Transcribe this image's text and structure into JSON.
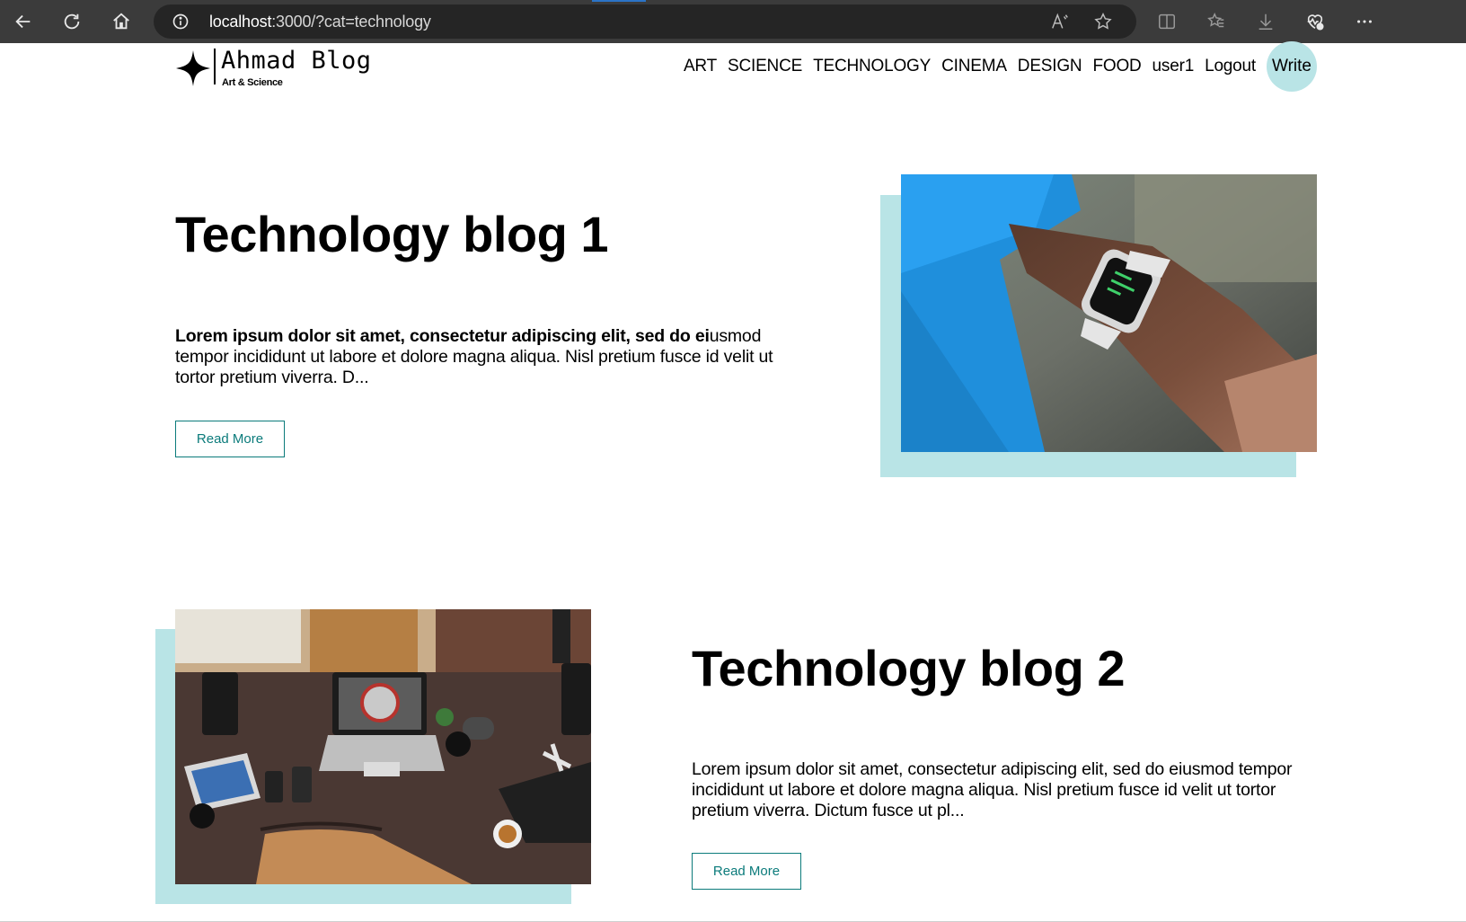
{
  "browser": {
    "url_host": "localhost",
    "url_rest": ":3000/?cat=technology",
    "icons": [
      "back-icon",
      "refresh-icon",
      "home-icon",
      "info-icon",
      "read-aloud-icon",
      "favorite-star-icon",
      "split-screen-icon",
      "favorites-list-icon",
      "downloads-icon",
      "browser-essentials-icon",
      "more-icon"
    ]
  },
  "header": {
    "logo_name": "Ahmad Blog",
    "logo_tagline": "Art & Science",
    "nav": [
      "ART",
      "SCIENCE",
      "TECHNOLOGY",
      "CINEMA",
      "DESIGN",
      "FOOD",
      "user1",
      "Logout"
    ],
    "write_label": "Write"
  },
  "posts": [
    {
      "title": "Technology blog 1",
      "desc_bold": "Lorem ipsum dolor sit amet, consectetur adipiscing elit, sed do ei",
      "desc_rest": "usmod tempor incididunt ut labore et dolore magna aliqua. Nisl pretium fusce id velit ut tortor pretium viverra. D...",
      "read_more": "Read More",
      "image": "smartwatch-on-wrist"
    },
    {
      "title": "Technology blog 2",
      "desc_bold": "",
      "desc_rest": "Lorem ipsum dolor sit amet, consectetur adipiscing elit, sed do eiusmod tempor incididunt ut labore et dolore magna aliqua. Nisl pretium fusce id velit ut tortor pretium viverra. Dictum fusce ut pl...",
      "read_more": "Read More",
      "image": "desk-with-laptop-and-gadgets"
    }
  ],
  "colors": {
    "accent": "#b9e4e6",
    "button_text": "#0b7b7b",
    "browser_bar": "#3b3b3b"
  }
}
